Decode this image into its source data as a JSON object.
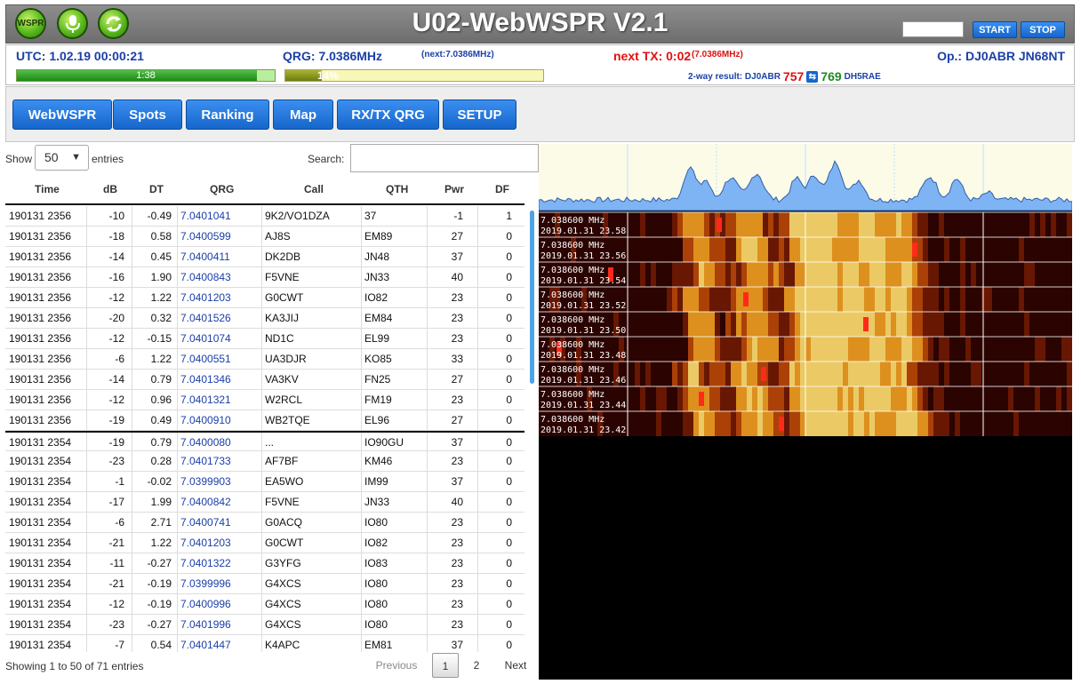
{
  "app": {
    "title": "U02-WebWSPR V2.1",
    "icons": [
      "wspr-logo-icon",
      "microphone-icon",
      "refresh-icon"
    ],
    "wspr_icon_text": "WSPR",
    "start_label": "START",
    "stop_label": "STOP"
  },
  "status": {
    "utc": "UTC: 1.02.19 00:00:21",
    "qrg": "QRG: 7.0386MHz",
    "next_qrg": "(next:7.0386MHz)",
    "next_tx": "next TX: 0:02",
    "next_tx_qrg": "(7.0386MHz)",
    "operator": "Op.: DJ0ABR JN68NT",
    "progress1_label": "1:38",
    "progress1_fraction": 0.93,
    "progress2_label": "14%",
    "progress2_fraction": 0.14,
    "twoway_label": "2-way result: DJ0ABR",
    "twoway_left": "757",
    "twoway_right": "769",
    "twoway_call": "DH5RAE",
    "twoway_swap_icon": "⇆"
  },
  "nav": {
    "webwspr": "WebWSPR",
    "spots": "Spots",
    "ranking": "Ranking",
    "map": "Map",
    "rxtx": "RX/TX QRG",
    "setup": "SETUP"
  },
  "table": {
    "show_label": "Show",
    "show_value": "50",
    "entries_label": "entries",
    "search_label": "Search:",
    "search_value": "",
    "columns": [
      "Time",
      "dB",
      "DT",
      "QRG",
      "Call",
      "QTH",
      "Pwr",
      "DF"
    ],
    "rows": [
      [
        "190131 2356",
        "-10",
        "-0.49",
        "7.0401041",
        "9K2/VO1DZA",
        "37",
        "-1",
        "1"
      ],
      [
        "190131 2356",
        "-18",
        "0.58",
        "7.0400599",
        "AJ8S",
        "EM89",
        "27",
        "0"
      ],
      [
        "190131 2356",
        "-14",
        "0.45",
        "7.0400411",
        "DK2DB",
        "JN48",
        "37",
        "0"
      ],
      [
        "190131 2356",
        "-16",
        "1.90",
        "7.0400843",
        "F5VNE",
        "JN33",
        "40",
        "0"
      ],
      [
        "190131 2356",
        "-12",
        "1.22",
        "7.0401203",
        "G0CWT",
        "IO82",
        "23",
        "0"
      ],
      [
        "190131 2356",
        "-20",
        "0.32",
        "7.0401526",
        "KA3JIJ",
        "EM84",
        "23",
        "0"
      ],
      [
        "190131 2356",
        "-12",
        "-0.15",
        "7.0401074",
        "ND1C",
        "EL99",
        "23",
        "0"
      ],
      [
        "190131 2356",
        "-6",
        "1.22",
        "7.0400551",
        "UA3DJR",
        "KO85",
        "33",
        "0"
      ],
      [
        "190131 2356",
        "-14",
        "0.79",
        "7.0401346",
        "VA3KV",
        "FN25",
        "27",
        "0"
      ],
      [
        "190131 2356",
        "-12",
        "0.96",
        "7.0401321",
        "W2RCL",
        "FM19",
        "23",
        "0"
      ],
      [
        "190131 2356",
        "-19",
        "0.49",
        "7.0400910",
        "WB2TQE",
        "EL96",
        "27",
        "0"
      ],
      [
        "190131 2354",
        "-19",
        "0.79",
        "7.0400080",
        "...",
        "IO90GU",
        "37",
        "0"
      ],
      [
        "190131 2354",
        "-23",
        "0.28",
        "7.0401733",
        "AF7BF",
        "KM46",
        "23",
        "0"
      ],
      [
        "190131 2354",
        "-1",
        "-0.02",
        "7.0399903",
        "EA5WO",
        "IM99",
        "37",
        "0"
      ],
      [
        "190131 2354",
        "-17",
        "1.99",
        "7.0400842",
        "F5VNE",
        "JN33",
        "40",
        "0"
      ],
      [
        "190131 2354",
        "-6",
        "2.71",
        "7.0400741",
        "G0ACQ",
        "IO80",
        "23",
        "0"
      ],
      [
        "190131 2354",
        "-21",
        "1.22",
        "7.0401203",
        "G0CWT",
        "IO82",
        "23",
        "0"
      ],
      [
        "190131 2354",
        "-11",
        "-0.27",
        "7.0401322",
        "G3YFG",
        "IO83",
        "23",
        "0"
      ],
      [
        "190131 2354",
        "-21",
        "-0.19",
        "7.0399996",
        "G4XCS",
        "IO80",
        "23",
        "0"
      ],
      [
        "190131 2354",
        "-12",
        "-0.19",
        "7.0400996",
        "G4XCS",
        "IO80",
        "23",
        "0"
      ],
      [
        "190131 2354",
        "-23",
        "-0.27",
        "7.0401996",
        "G4XCS",
        "IO80",
        "23",
        "0"
      ],
      [
        "190131 2354",
        "-7",
        "0.54",
        "7.0401447",
        "K4APC",
        "EM81",
        "37",
        "0"
      ]
    ],
    "footer_info": "Showing 1 to 50 of 71 entries",
    "prev_label": "Previous",
    "page1": "1",
    "page2": "2",
    "next_label": "Next"
  },
  "waterfall": {
    "freq_label": "7.038600 MHz",
    "times": [
      "2019.01.31 23.58",
      "2019.01.31 23.56",
      "2019.01.31 23.54",
      "2019.01.31 23.52",
      "2019.01.31 23.50",
      "2019.01.31 23.48",
      "2019.01.31 23.46",
      "2019.01.31 23.44",
      "2019.01.31 23.42"
    ]
  },
  "colors": {
    "accent_blue": "#1666cc",
    "header_grey": "#7d7d7d",
    "status_blue": "#1b3fa8",
    "status_red": "#e01010",
    "progress_green": "#2f9a22",
    "spectrum_fill": "#7fb4f4"
  }
}
